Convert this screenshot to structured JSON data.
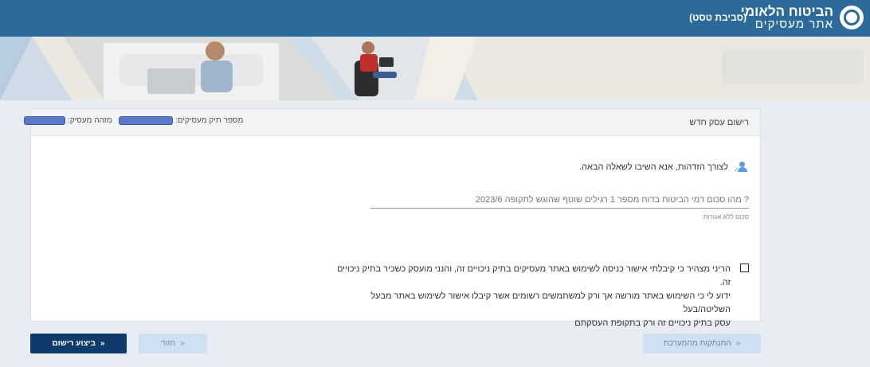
{
  "header": {
    "brand_line1": "הביטוח הלאומי",
    "brand_line2": "אתר מעסיקים",
    "environment": "(סביבת טסט)"
  },
  "card": {
    "title": "רישום עסק חדש",
    "employer_file_label": "מספר תיק מעסיקים:",
    "employer_id_label": "מזהה מעסיק:"
  },
  "identity": {
    "prompt": "לצורך הזדהות, אנא השיבו לשאלה הבאה.",
    "question_placeholder": "? מהו סכום דמי הביטוח בדוח מספר 1 רגילים שוטף שהוגש לתקופה 2023/6",
    "question_value": "",
    "hint": "סכום ללא אגורות"
  },
  "declaration": {
    "checked": false,
    "line1": "הריני מצהיר כי קיבלתי אישור כניסה לשימוש באתר מעסיקים בתיק ניכויים זה, והנני מועסק כשכיר בתיק ניכויים זה.",
    "line2": "ידוע לי כי השימוש באתר מורשה אך ורק למשתמשים רשומים אשר קיבלו אישור לשימוש באתר מבעל השליטה/בעל",
    "line3": "עסק בתיק ניכויים זה ורק בתקופת העסקתם"
  },
  "buttons": {
    "submit": "ביצוע רישום",
    "back": "חזור",
    "logout": "התנתקות מהמערכת",
    "arrow": "»"
  },
  "colors": {
    "topbar": "#2b6a9a",
    "primary_button": "#0f3b6a",
    "secondary_button": "#cfe0f2",
    "masked": "#5b79c7"
  }
}
